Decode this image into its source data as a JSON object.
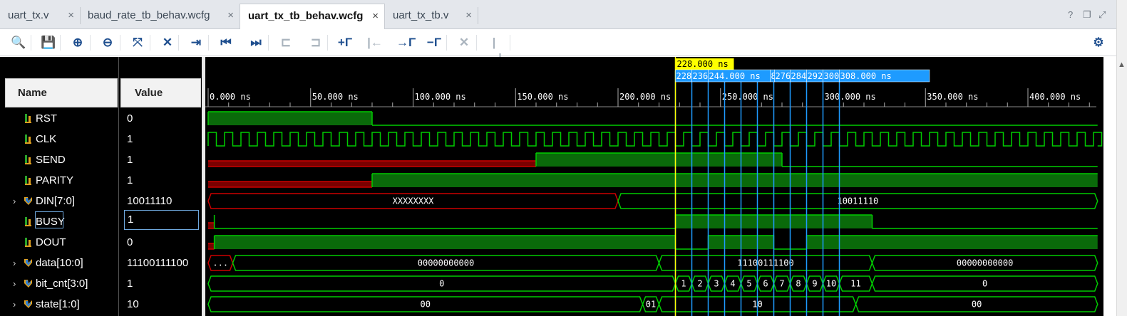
{
  "tabs": [
    {
      "label": "uart_tx.v",
      "close": "×",
      "active": false
    },
    {
      "label": "baud_rate_tb_behav.wcfg",
      "close": "×",
      "active": false
    },
    {
      "label": "uart_tx_tb_behav.wcfg",
      "close": "×",
      "active": true
    },
    {
      "label": "uart_tx_tb.v",
      "close": "×",
      "active": false
    }
  ],
  "window_buttons": [
    "?",
    "❐",
    "⤢"
  ],
  "toolbar": {
    "buttons": [
      {
        "name": "zoom-search-icon",
        "glyph": "🔍",
        "enabled": true
      },
      {
        "name": "save-icon",
        "glyph": "💾",
        "enabled": true
      },
      {
        "name": "zoom-in-icon",
        "glyph": "⊕",
        "enabled": true
      },
      {
        "name": "zoom-out-icon",
        "glyph": "⊖",
        "enabled": true
      },
      {
        "name": "zoom-fit-icon",
        "glyph": "⤧",
        "enabled": true
      },
      {
        "name": "cursor-to-selected-icon",
        "glyph": "✕",
        "enabled": true
      },
      {
        "name": "go-to-time-zero-icon",
        "glyph": "⇥",
        "enabled": true
      },
      {
        "name": "go-to-first-icon",
        "glyph": "⏮",
        "enabled": true
      },
      {
        "name": "go-to-last-icon",
        "glyph": "⏭",
        "enabled": true
      },
      {
        "name": "previous-transition-icon",
        "glyph": "⊏",
        "enabled": false
      },
      {
        "name": "next-transition-icon",
        "glyph": "⊐",
        "enabled": false
      },
      {
        "name": "add-marker-icon",
        "glyph": "+Γ",
        "enabled": true
      },
      {
        "name": "previous-marker-icon",
        "glyph": "|←",
        "enabled": false
      },
      {
        "name": "next-marker-icon",
        "glyph": "→Γ",
        "enabled": true
      },
      {
        "name": "delete-marker-icon",
        "glyph": "−Γ",
        "enabled": true
      },
      {
        "name": "delete-all-markers-icon",
        "glyph": "✕",
        "enabled": false
      },
      {
        "name": "swap-cursors-icon",
        "glyph": "|↔|",
        "enabled": false
      }
    ],
    "settings_icon": "⚙"
  },
  "columns": {
    "name": "Name",
    "value": "Value"
  },
  "signals": [
    {
      "name": "RST",
      "value": "0",
      "type": "bit",
      "expandable": false
    },
    {
      "name": "CLK",
      "value": "1",
      "type": "bit",
      "expandable": false
    },
    {
      "name": "SEND",
      "value": "1",
      "type": "bit",
      "expandable": false
    },
    {
      "name": "PARITY",
      "value": "1",
      "type": "bit",
      "expandable": false
    },
    {
      "name": "DIN[7:0]",
      "value": "10011110",
      "type": "bus",
      "expandable": true
    },
    {
      "name": "BUSY",
      "value": "1",
      "type": "bit",
      "expandable": false,
      "selected": true
    },
    {
      "name": "DOUT",
      "value": "0",
      "type": "bit",
      "expandable": false
    },
    {
      "name": "data[10:0]",
      "value": "11100111100",
      "type": "bus",
      "expandable": true
    },
    {
      "name": "bit_cnt[3:0]",
      "value": "1",
      "type": "bus",
      "expandable": true
    },
    {
      "name": "state[1:0]",
      "value": "10",
      "type": "bus",
      "expandable": true
    }
  ],
  "timeline": {
    "unit": "ns",
    "ticks": [
      "0.000 ns",
      "50.000 ns",
      "100.000 ns",
      "150.000 ns",
      "200.000 ns",
      "250.000 ns",
      "300.000 ns",
      "350.000 ns",
      "400.000 ns"
    ],
    "main_cursor": "228.000 ns",
    "marker_labels": [
      "228",
      "236",
      "244.000 ns",
      "8",
      "276",
      "284",
      "292",
      "300",
      "308.000 ns"
    ],
    "clock_period_ns": 8
  },
  "waves": {
    "RST": [
      [
        0,
        80,
        1
      ],
      [
        80,
        434,
        0
      ]
    ],
    "SEND": [
      [
        0,
        160,
        0
      ],
      [
        160,
        280,
        1
      ],
      [
        280,
        434,
        0
      ]
    ],
    "PARITY": [
      [
        0,
        80,
        0
      ],
      [
        80,
        434,
        1
      ]
    ],
    "DIN": [
      {
        "from": 0,
        "to": 200,
        "label": "XXXXXXXX",
        "undefined": true
      },
      {
        "from": 200,
        "to": 434,
        "label": "10011110"
      }
    ],
    "BUSY": [
      [
        0,
        3,
        0
      ],
      [
        3,
        228,
        0
      ],
      [
        228,
        324,
        1
      ],
      [
        324,
        434,
        0
      ]
    ],
    "DOUT": [
      [
        0,
        3,
        0
      ],
      [
        3,
        228,
        1
      ],
      [
        228,
        244,
        0
      ],
      [
        244,
        276,
        1
      ],
      [
        276,
        292,
        0
      ],
      [
        292,
        434,
        1
      ]
    ],
    "data": [
      {
        "from": 0,
        "to": 12,
        "label": "...",
        "undefined": true
      },
      {
        "from": 12,
        "to": 220,
        "label": "00000000000"
      },
      {
        "from": 220,
        "to": 324,
        "label": "11100111100"
      },
      {
        "from": 324,
        "to": 434,
        "label": "00000000000"
      }
    ],
    "bit_cnt": [
      {
        "from": 0,
        "to": 228,
        "label": "0"
      },
      {
        "from": 228,
        "to": 236,
        "label": "1"
      },
      {
        "from": 236,
        "to": 244,
        "label": "2"
      },
      {
        "from": 244,
        "to": 252,
        "label": "3"
      },
      {
        "from": 252,
        "to": 260,
        "label": "4"
      },
      {
        "from": 260,
        "to": 268,
        "label": "5"
      },
      {
        "from": 268,
        "to": 276,
        "label": "6"
      },
      {
        "from": 276,
        "to": 284,
        "label": "7"
      },
      {
        "from": 284,
        "to": 292,
        "label": "8"
      },
      {
        "from": 292,
        "to": 300,
        "label": "9"
      },
      {
        "from": 300,
        "to": 308,
        "label": "10"
      },
      {
        "from": 308,
        "to": 324,
        "label": "11"
      },
      {
        "from": 324,
        "to": 434,
        "label": "0"
      }
    ],
    "state": [
      {
        "from": 0,
        "to": 212,
        "label": "00"
      },
      {
        "from": 212,
        "to": 220,
        "label": "01"
      },
      {
        "from": 220,
        "to": 316,
        "label": "10"
      },
      {
        "from": 316,
        "to": 434,
        "label": "00"
      }
    ]
  },
  "markers_ns": [
    228,
    236,
    244,
    252,
    260,
    268,
    276,
    284,
    292,
    300,
    308
  ],
  "colors": {
    "wave": "#00cc00",
    "wave_fill": "#0a6a0a",
    "undefined": "#cc0000",
    "undefined_fill": "#7a0000",
    "cursor": "#ffff00",
    "marker": "#1e9bff"
  }
}
